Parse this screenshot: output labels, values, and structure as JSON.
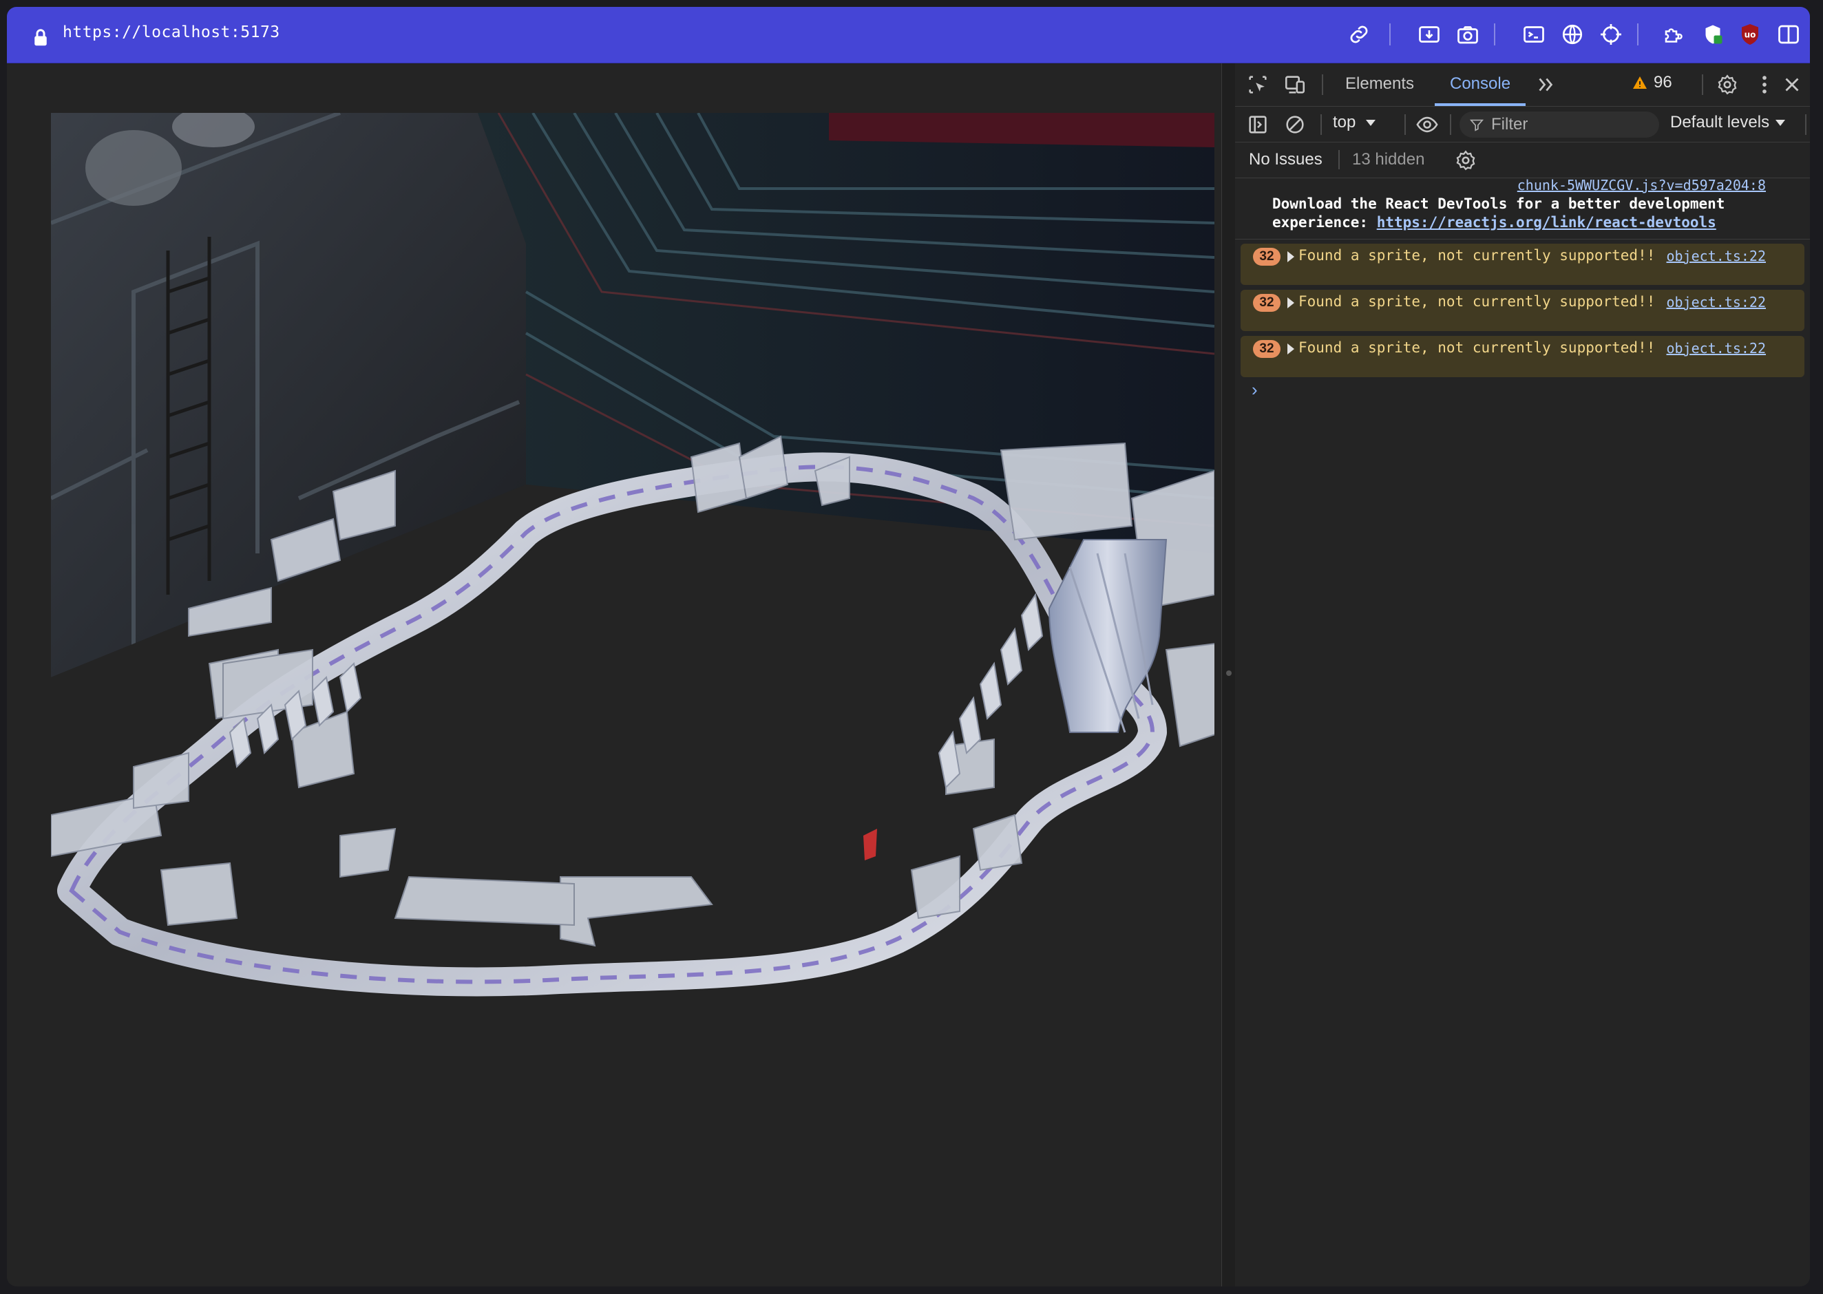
{
  "browser": {
    "url": "https://localhost:5173"
  },
  "devtools": {
    "tabs": {
      "elements": "Elements",
      "console": "Console"
    },
    "warnings_count": "96",
    "context": "top",
    "filter_placeholder": "Filter",
    "levels": "Default levels",
    "issues": {
      "label": "No Issues",
      "hidden": "13 hidden"
    },
    "messages": {
      "info": {
        "source": "chunk-5WWUZCGV.js?v=d597a204:8",
        "text_before": "Download the React DevTools for a better development experience: ",
        "link": "https://reactjs.org/link/react-devtools"
      },
      "warnings": [
        {
          "count": "32",
          "text": "Found a sprite, not currently supported!!",
          "source": "object.ts:22"
        },
        {
          "count": "32",
          "text": "Found a sprite, not currently supported!!",
          "source": "object.ts:22"
        },
        {
          "count": "32",
          "text": "Found a sprite, not currently supported!!",
          "source": "object.ts:22"
        }
      ],
      "prompt": "›"
    }
  },
  "colors": {
    "toolbar": "#4545d6",
    "accent": "#8ab4f8",
    "warning_bg": "#413a22",
    "warning_text": "#f2d68a",
    "badge": "#e8905f"
  },
  "icons": [
    "lock-icon",
    "link-icon",
    "download-icon",
    "camera-icon",
    "terminal-icon",
    "globe-icon",
    "crosshair-icon",
    "extensions-icon",
    "shield-icon",
    "ublock-icon",
    "sidebar-icon",
    "inspect-icon",
    "device-icon",
    "more-tabs-icon",
    "warning-icon",
    "settings-icon",
    "menu-icon",
    "close-icon",
    "dock-icon",
    "clear-icon",
    "eye-icon",
    "filter-icon",
    "gear-icon"
  ]
}
